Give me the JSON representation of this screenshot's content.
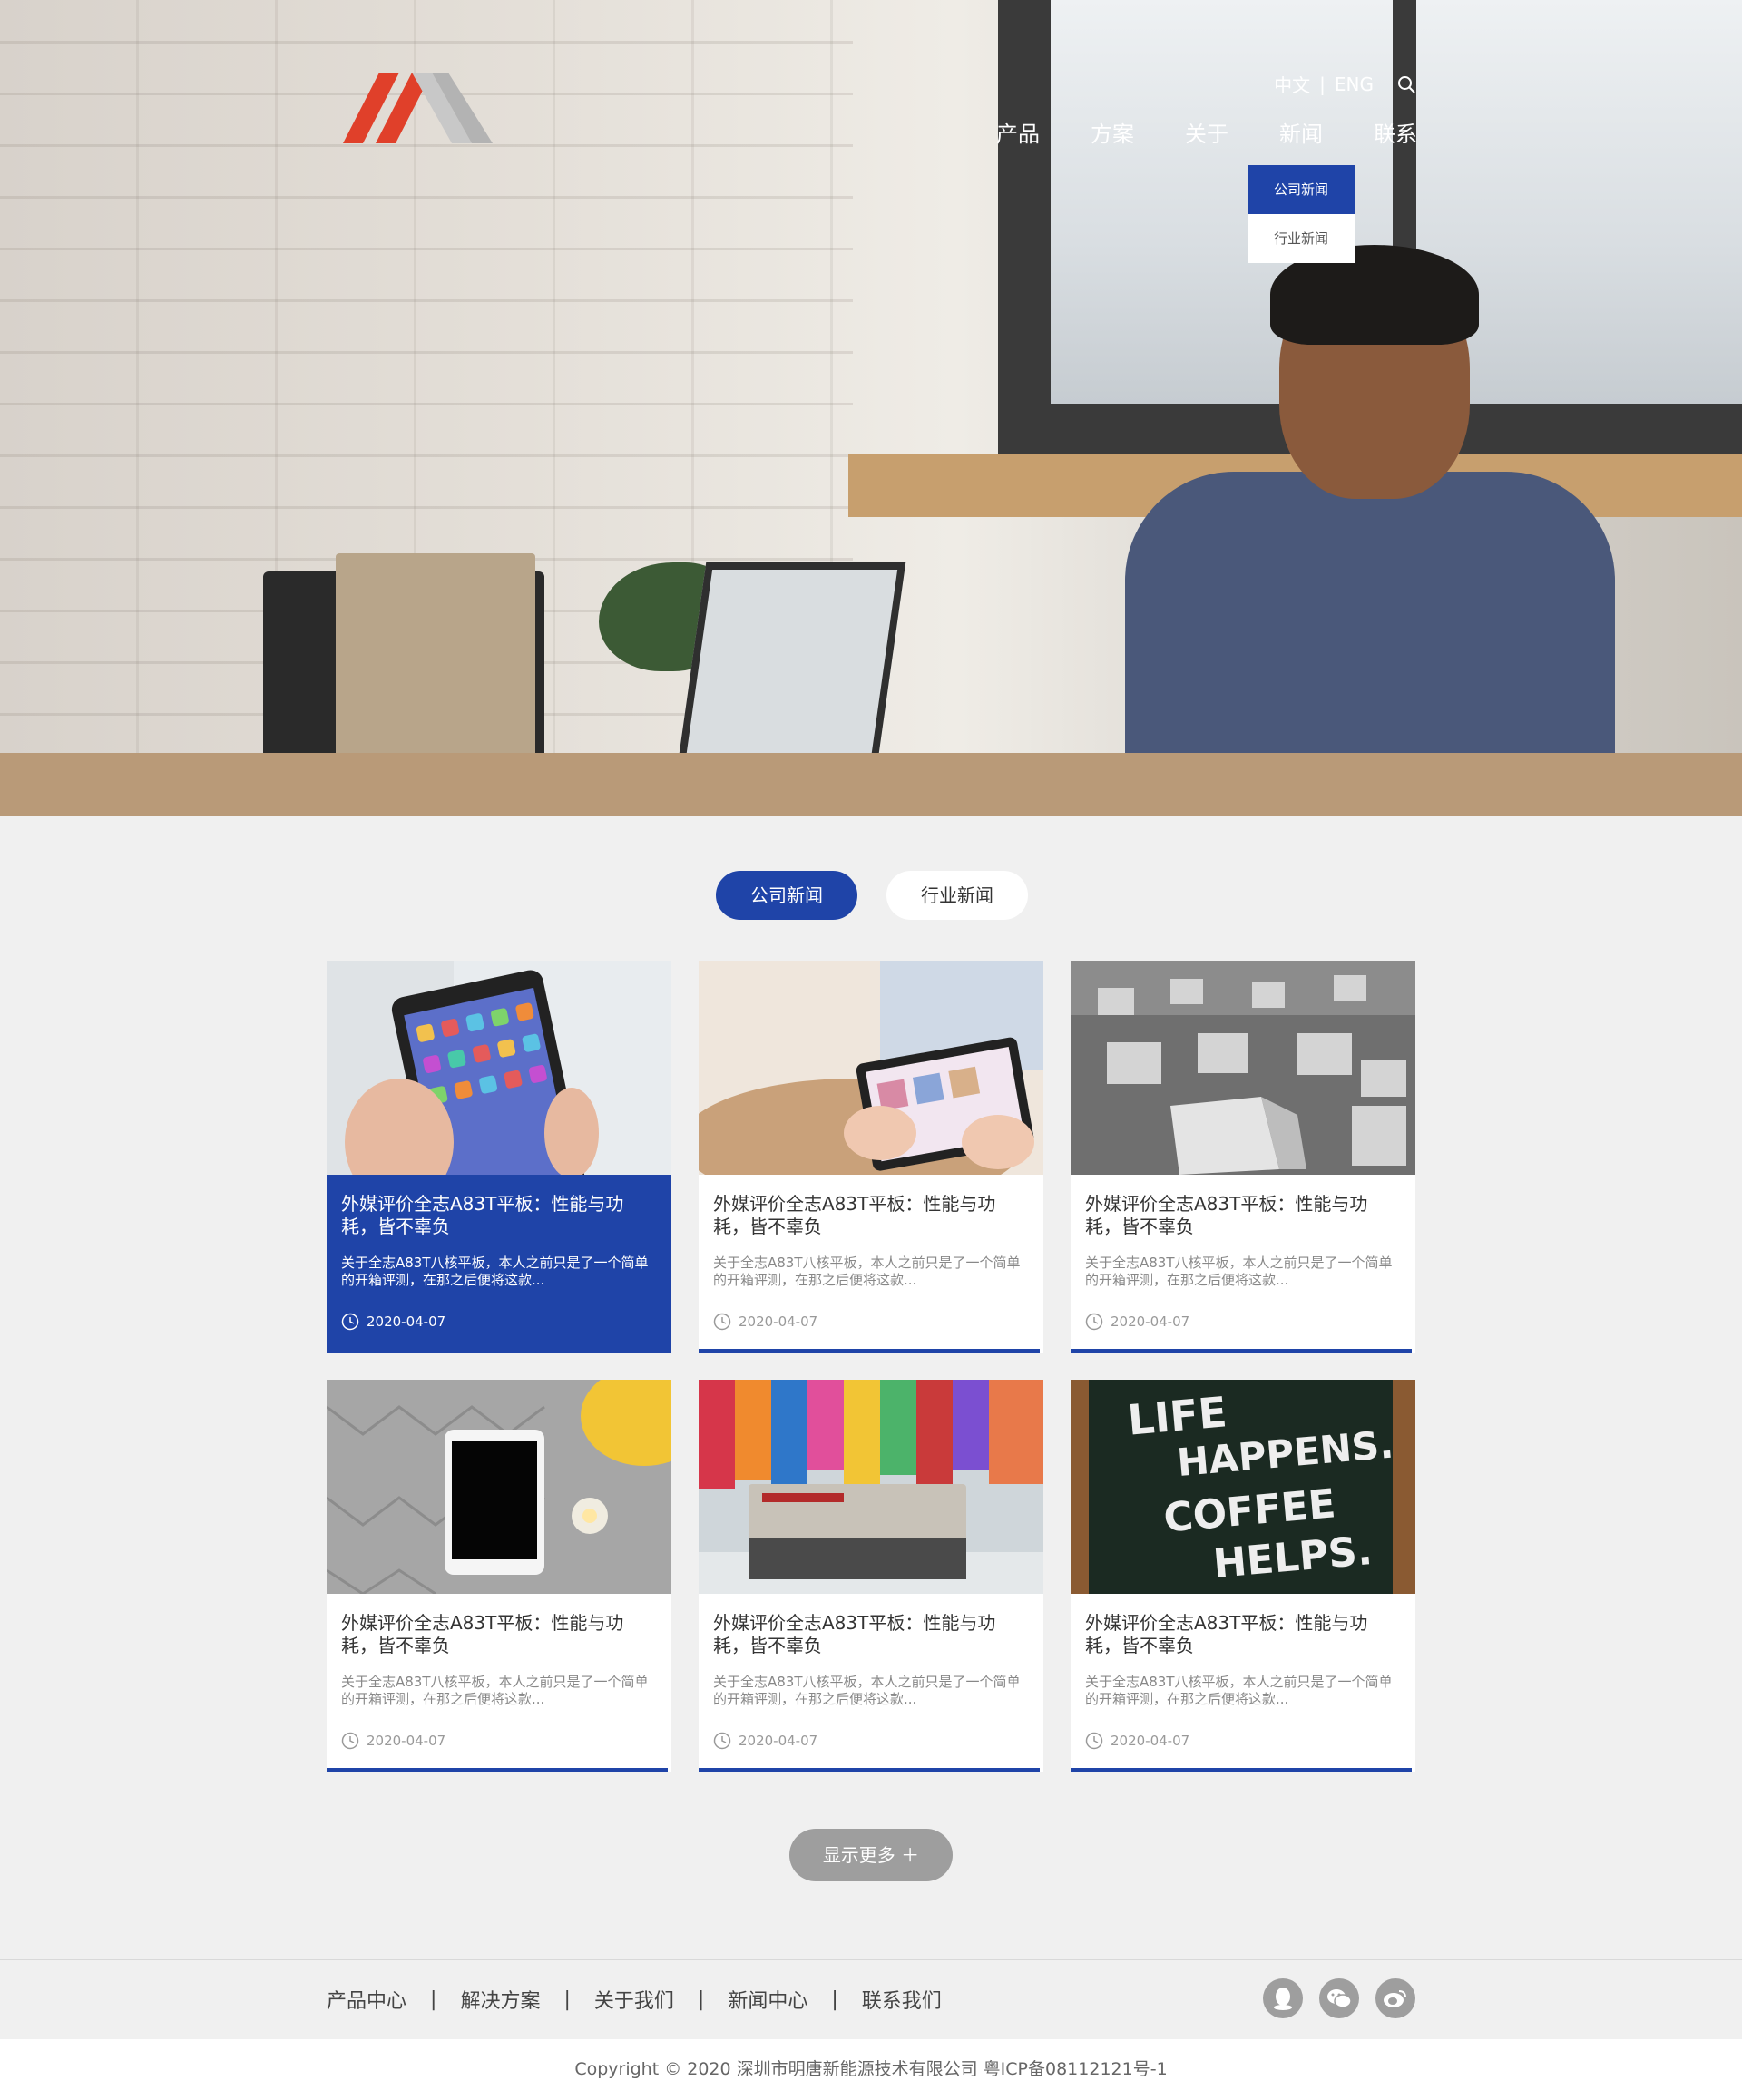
{
  "header": {
    "lang_cn": "中文",
    "lang_divider": "|",
    "lang_en": "ENG",
    "nav": [
      "产品",
      "方案",
      "关于",
      "新闻",
      "联系"
    ],
    "dropdown": [
      "公司新闻",
      "行业新闻"
    ],
    "search_icon": "search-icon"
  },
  "news": {
    "tabs": [
      "公司新闻",
      "行业新闻"
    ],
    "active_tab": "公司新闻",
    "cards": [
      {
        "title": "外媒评价全志A83T平板：性能与功耗，皆不辜负",
        "desc": "关于全志A83T八核平板，本人之前只是了一个简单的开箱评测，在那之后便将这款...",
        "date": "2020-04-07"
      },
      {
        "title": "外媒评价全志A83T平板：性能与功耗，皆不辜负",
        "desc": "关于全志A83T八核平板，本人之前只是了一个简单的开箱评测，在那之后便将这款...",
        "date": "2020-04-07"
      },
      {
        "title": "外媒评价全志A83T平板：性能与功耗，皆不辜负",
        "desc": "关于全志A83T八核平板，本人之前只是了一个简单的开箱评测，在那之后便将这款...",
        "date": "2020-04-07"
      },
      {
        "title": "外媒评价全志A83T平板：性能与功耗，皆不辜负",
        "desc": "关于全志A83T八核平板，本人之前只是了一个简单的开箱评测，在那之后便将这款...",
        "date": "2020-04-07"
      },
      {
        "title": "外媒评价全志A83T平板：性能与功耗，皆不辜负",
        "desc": "关于全志A83T八核平板，本人之前只是了一个简单的开箱评测，在那之后便将这款...",
        "date": "2020-04-07"
      },
      {
        "title": "外媒评价全志A83T平板：性能与功耗，皆不辜负",
        "desc": "关于全志A83T八核平板，本人之前只是了一个简单的开箱评测，在那之后便将这款...",
        "date": "2020-04-07"
      }
    ],
    "more_label": "显示更多 ＋"
  },
  "thumb_text": {
    "letterboard": "LIFE HAPPENS. COFFEE HELPS."
  },
  "footer": {
    "links": [
      "产品中心",
      "解决方案",
      "关于我们",
      "新闻中心",
      "联系我们"
    ],
    "separator": "|",
    "social_icons": [
      "qq-icon",
      "wechat-icon",
      "weibo-icon"
    ],
    "copyright": "Copyright © 2020   深圳市明唐新能源技术有限公司   粤ICP备08112121号-1"
  },
  "colors": {
    "brand_blue": "#1f44a8",
    "logo_red": "#e0402a",
    "logo_grey": "#bdbdbd",
    "footer_btn": "#9e9e9e"
  }
}
